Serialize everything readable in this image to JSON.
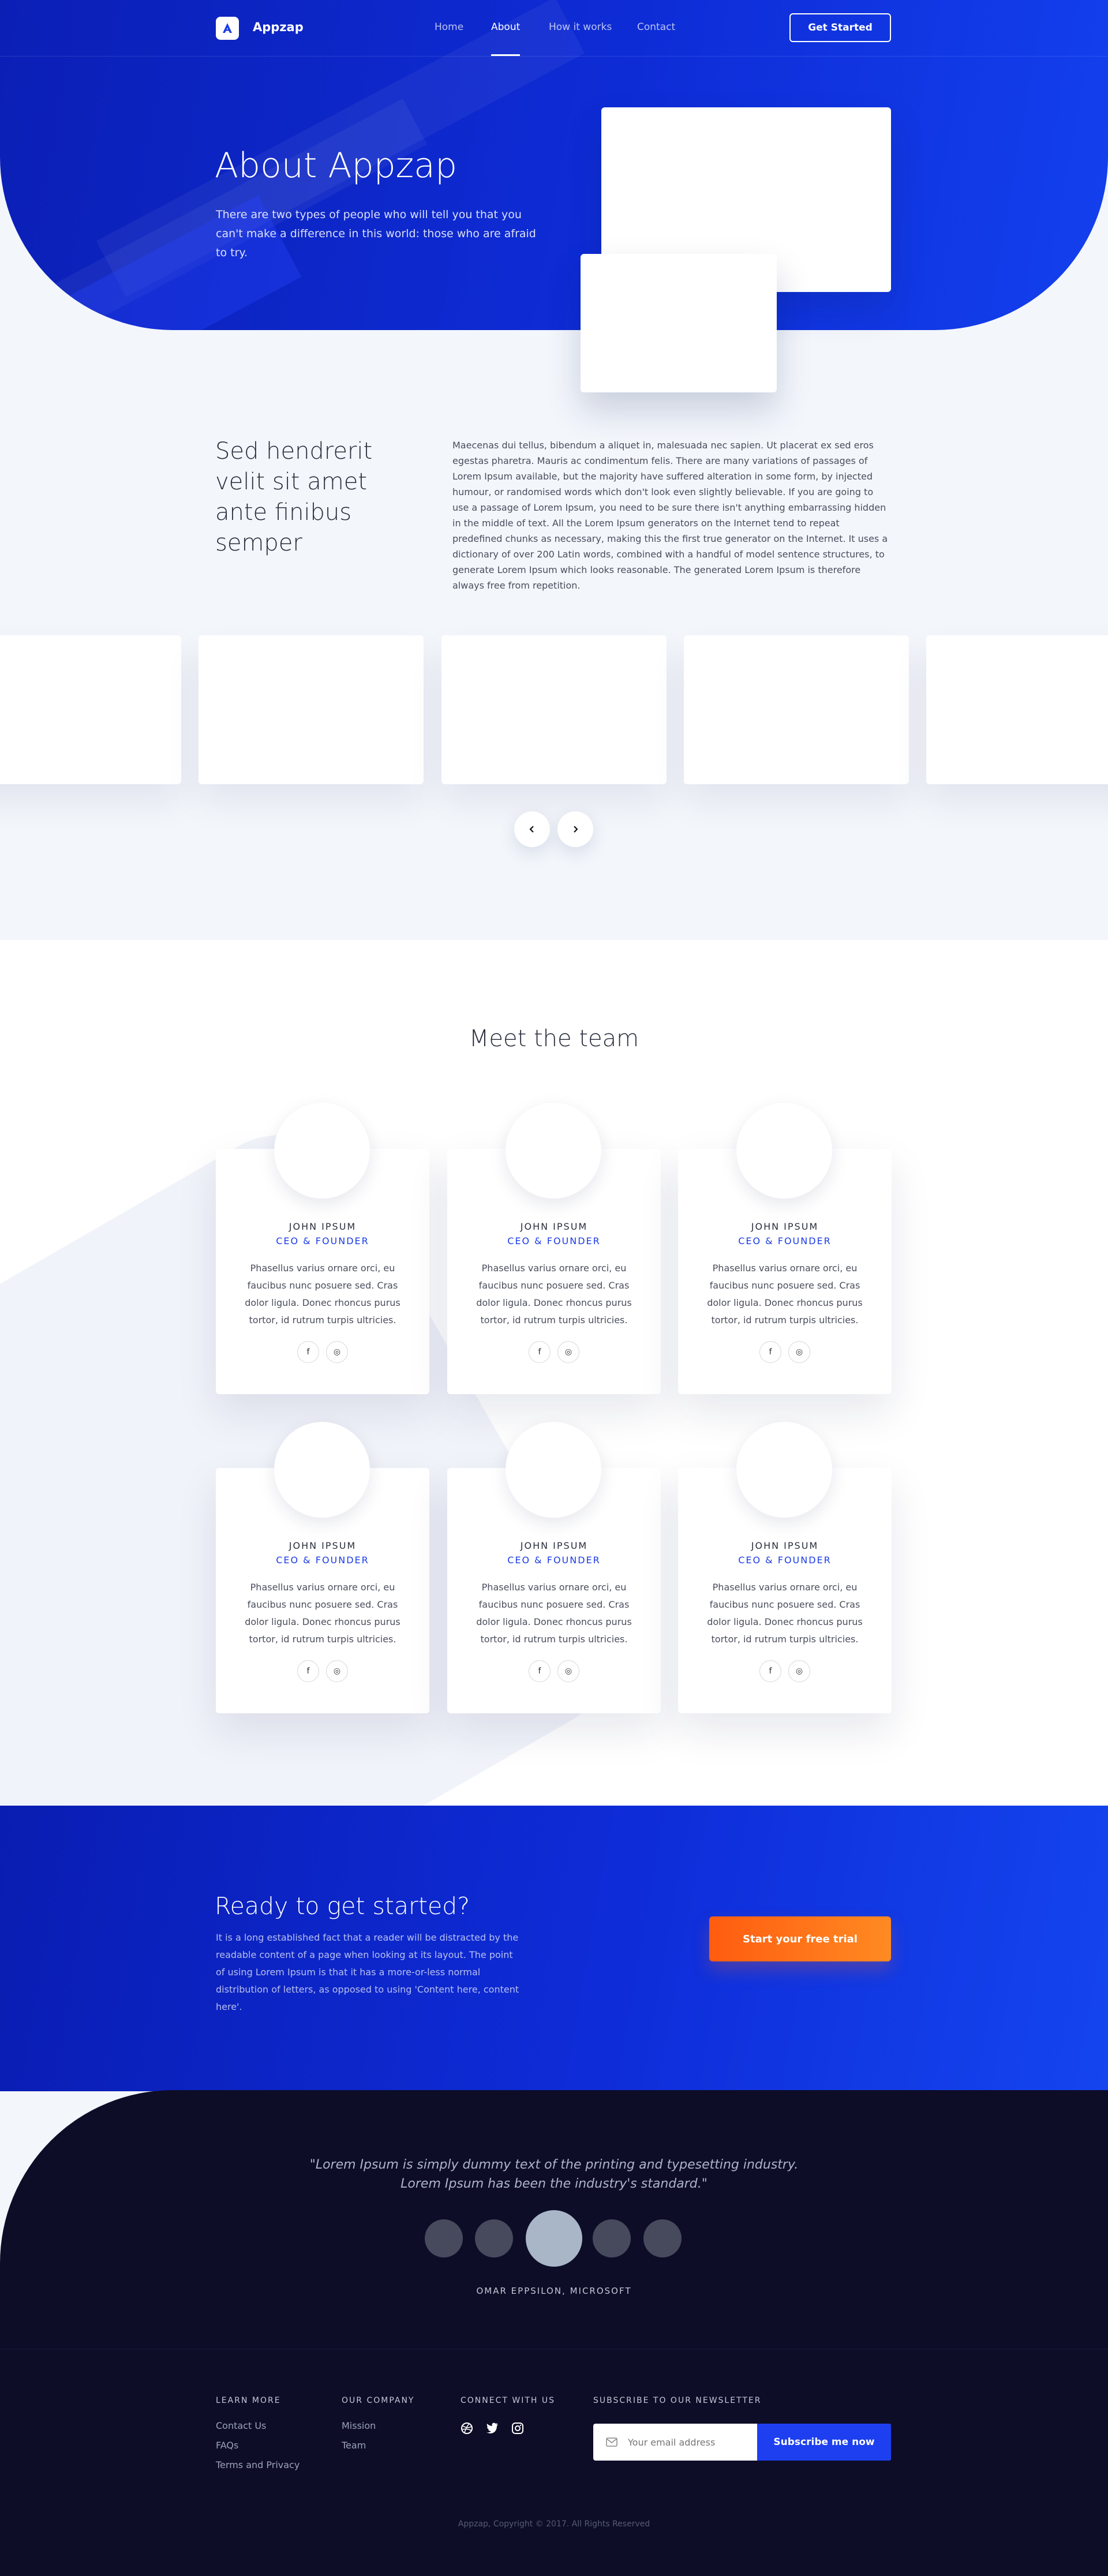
{
  "nav": {
    "brand": "Appzap",
    "links": [
      "Home",
      "About",
      "How it works",
      "Contact"
    ],
    "active": "About",
    "cta": "Get Started"
  },
  "hero": {
    "title": "About Appzap",
    "subtitle": "There are two types of people who will tell you that you can't make a difference in this world: those who are afraid to try."
  },
  "about": {
    "heading": "Sed hendrerit velit sit amet ante finibus semper",
    "body": "Maecenas dui tellus, bibendum a aliquet in, malesuada nec sapien. Ut placerat ex sed eros egestas pharetra. Mauris ac condimentum felis. There are many variations of passages of Lorem Ipsum available, but the majority have suffered alteration in some form, by injected humour, or randomised words which don't look even slightly believable. If you are going to use a passage of Lorem Ipsum, you need to be sure there isn't anything embarrassing hidden in the middle of text. All the Lorem Ipsum generators on the Internet tend to repeat predefined chunks as necessary, making this the first true generator on the Internet. It uses a dictionary of over 200 Latin words, combined with a handful of model sentence structures, to generate Lorem Ipsum which looks reasonable. The generated Lorem Ipsum is therefore always free from repetition.",
    "carousel_prev_icon": "chevron-left-icon",
    "carousel_next_icon": "chevron-right-icon"
  },
  "team": {
    "title": "Meet the team",
    "members": [
      {
        "name": "JOHN IPSUM",
        "role": "CEO & FOUNDER",
        "bio": "Phasellus varius ornare orci, eu faucibus nunc posuere sed. Cras dolor ligula. Donec rhoncus purus tortor, id rutrum turpis ultricies."
      },
      {
        "name": "JOHN IPSUM",
        "role": "CEO & FOUNDER",
        "bio": "Phasellus varius ornare orci, eu faucibus nunc posuere sed. Cras dolor ligula. Donec rhoncus purus tortor, id rutrum turpis ultricies."
      },
      {
        "name": "JOHN IPSUM",
        "role": "CEO & FOUNDER",
        "bio": "Phasellus varius ornare orci, eu faucibus nunc posuere sed. Cras dolor ligula. Donec rhoncus purus tortor, id rutrum turpis ultricies."
      },
      {
        "name": "JOHN IPSUM",
        "role": "CEO & FOUNDER",
        "bio": "Phasellus varius ornare orci, eu faucibus nunc posuere sed. Cras dolor ligula. Donec rhoncus purus tortor, id rutrum turpis ultricies."
      },
      {
        "name": "JOHN IPSUM",
        "role": "CEO & FOUNDER",
        "bio": "Phasellus varius ornare orci, eu faucibus nunc posuere sed. Cras dolor ligula. Donec rhoncus purus tortor, id rutrum turpis ultricies."
      },
      {
        "name": "JOHN IPSUM",
        "role": "CEO & FOUNDER",
        "bio": "Phasellus varius ornare orci, eu faucibus nunc posuere sed. Cras dolor ligula. Donec rhoncus purus tortor, id rutrum turpis ultricies."
      }
    ],
    "social_icons": [
      "facebook-icon",
      "instagram-icon"
    ]
  },
  "cta": {
    "title": "Ready to get started?",
    "text": "It is a long established fact that a reader will be distracted by the readable content of a page when looking at its layout. The point of using Lorem Ipsum is that it has a more-or-less normal distribution of letters, as opposed to using 'Content here, content here'.",
    "button": "Start your free trial"
  },
  "testimonial": {
    "quote": "\"Lorem Ipsum is simply dummy text of the printing and typesetting industry. Lorem Ipsum has been the industry's standard.\"",
    "author": "OMAR EPPSILON, MICROSOFT"
  },
  "footer": {
    "learn_more": {
      "title": "LEARN MORE",
      "links": [
        "Contact Us",
        "FAQs",
        "Terms and Privacy"
      ]
    },
    "company": {
      "title": "OUR COMPANY",
      "links": [
        "Mission",
        "Team"
      ]
    },
    "connect": {
      "title": "CONNECT WITH US",
      "icons": [
        "dribbble-icon",
        "twitter-icon",
        "instagram-icon"
      ]
    },
    "newsletter": {
      "title": "SUBSCRIBE TO OUR NEWSLETTER",
      "placeholder": "Your email address",
      "button": "Subscribe me now"
    },
    "copyright": "Appzap, Copyright © 2017. All Rights Reserved"
  },
  "colors": {
    "primary": "#0e2cd6",
    "accent_orange": "#ff6a14",
    "footer_bg": "#0d0d28"
  }
}
